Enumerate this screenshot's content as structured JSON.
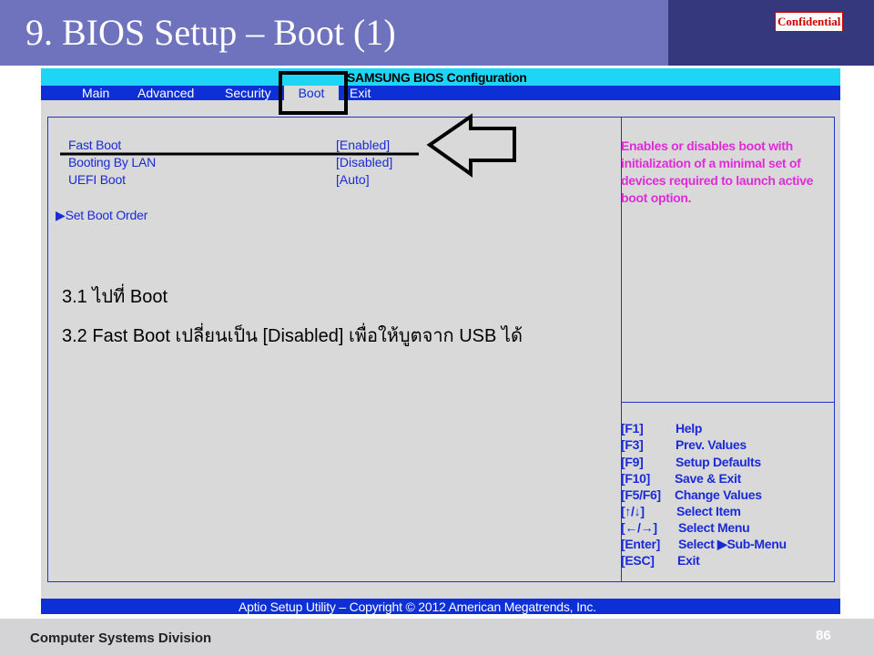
{
  "slide": {
    "title": "9. BIOS Setup – Boot (1)",
    "confidential": "Confidential",
    "footer_division": "Computer Systems  Division",
    "page_number": "86"
  },
  "bios": {
    "title": "SAMSUNG BIOS Configuration",
    "tabs": [
      {
        "label": "Main"
      },
      {
        "label": "Advanced"
      },
      {
        "label": "Security"
      },
      {
        "label": "Boot",
        "active": true
      },
      {
        "label": "Exit"
      }
    ],
    "options": [
      {
        "label": "Fast Boot",
        "value": "[Enabled]"
      },
      {
        "label": "Booting By LAN",
        "value": "[Disabled]"
      },
      {
        "label": "UEFI Boot",
        "value": "[Auto]"
      }
    ],
    "submenu": "Set Boot Order",
    "help_text": "Enables or disables boot with initialization of a minimal set of devices required to launch active boot option.",
    "keys": [
      {
        "key": "[F1]",
        "desc": "Help"
      },
      {
        "key": "[F3]",
        "desc": "Prev. Values"
      },
      {
        "key": "[F9]",
        "desc": "Setup Defaults"
      },
      {
        "key": "[F10]",
        "desc": "Save & Exit"
      },
      {
        "key": "[F5/F6]",
        "desc": "Change Values"
      },
      {
        "key": "[↑/↓]",
        "desc": "Select Item"
      },
      {
        "key": "[←/→]",
        "desc": "Select Menu"
      },
      {
        "key": "[Enter]",
        "desc": "Select ▶Sub-Menu"
      },
      {
        "key": "[ESC]",
        "desc": "Exit"
      }
    ],
    "footer": "Aptio Setup Utility – Copyright © 2012 American Megatrends, Inc."
  },
  "notes": [
    "3.1 ไปที่ Boot",
    "3.2 Fast Boot เปลี่ยนเป็น [Disabled] เพื่อให้บูตจาก USB ได้"
  ],
  "colors": {
    "header": "#6f73bd",
    "header_dark": "#35387c",
    "bios_bg": "#d9d9d9",
    "bios_blue": "#0c2fd6",
    "title_cyan": "#1fd5f5",
    "help_magenta": "#e02bd9"
  }
}
